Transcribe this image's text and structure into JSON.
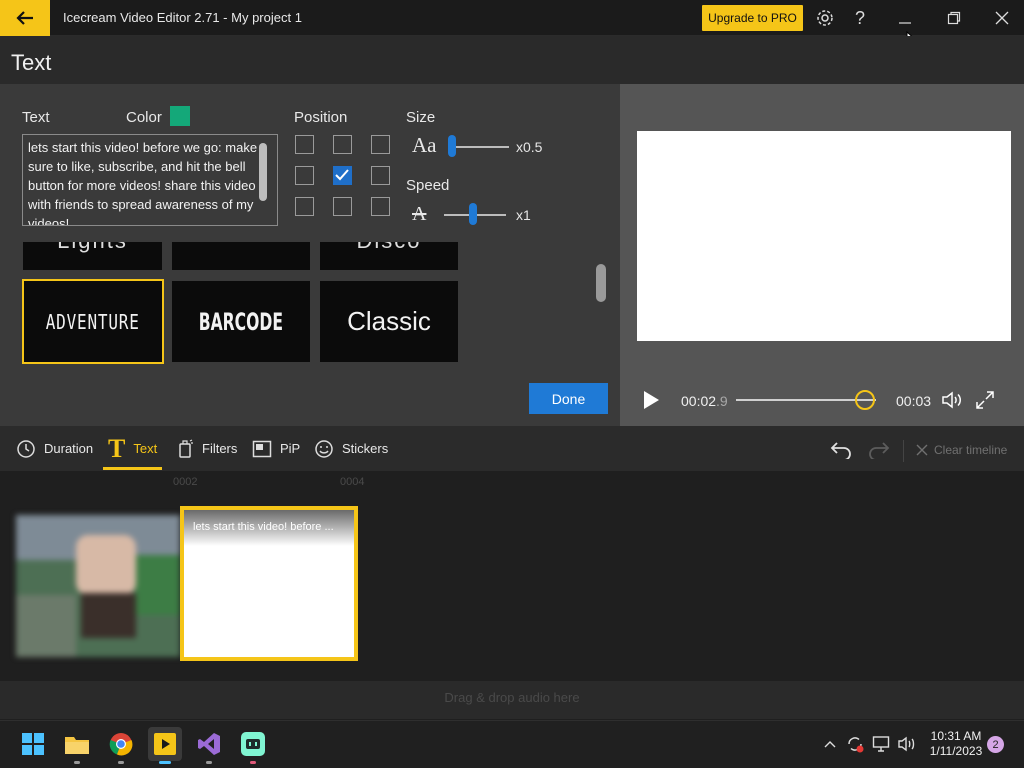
{
  "window": {
    "title": "Icecream Video Editor 2.71  -  My project 1",
    "upgrade_label": "Upgrade to PRO"
  },
  "panel": {
    "title": "Text",
    "text_label": "Text",
    "color_label": "Color",
    "color_value": "#14a879",
    "position_label": "Position",
    "size_label": "Size",
    "size_value": "x0.5",
    "speed_label": "Speed",
    "speed_value": "x1",
    "text_content": "lets start this video! before we go: make sure to like, subscribe, and hit the bell button for more videos! share this video with friends to spread awareness of my videos!",
    "position_grid": [
      [
        false,
        false,
        false
      ],
      [
        false,
        true,
        false
      ],
      [
        false,
        false,
        false
      ]
    ],
    "styles_partial": [
      "Lights",
      "",
      "Disco"
    ],
    "styles": [
      "ADVENTURE",
      "BARCODE",
      "Classic"
    ],
    "done_label": "Done"
  },
  "player": {
    "time_current": "00:02",
    "time_fraction": ".9",
    "time_total": "00:03",
    "progress": 0.92
  },
  "tabs": {
    "duration": "Duration",
    "text": "Text",
    "filters": "Filters",
    "pip": "PiP",
    "stickers": "Stickers",
    "clear_timeline": "Clear timeline"
  },
  "timeline": {
    "ruler": [
      "0002",
      "0004"
    ],
    "text_clip_label": "lets start this video! before ...",
    "audio_hint": "Drag & drop audio here"
  },
  "taskbar": {
    "time": "10:31 AM",
    "date": "1/11/2023",
    "notifications": "2"
  },
  "colors": {
    "accent": "#f5c518",
    "primary_button": "#1f7ad6",
    "checkbox_checked": "#1f6fc9"
  }
}
